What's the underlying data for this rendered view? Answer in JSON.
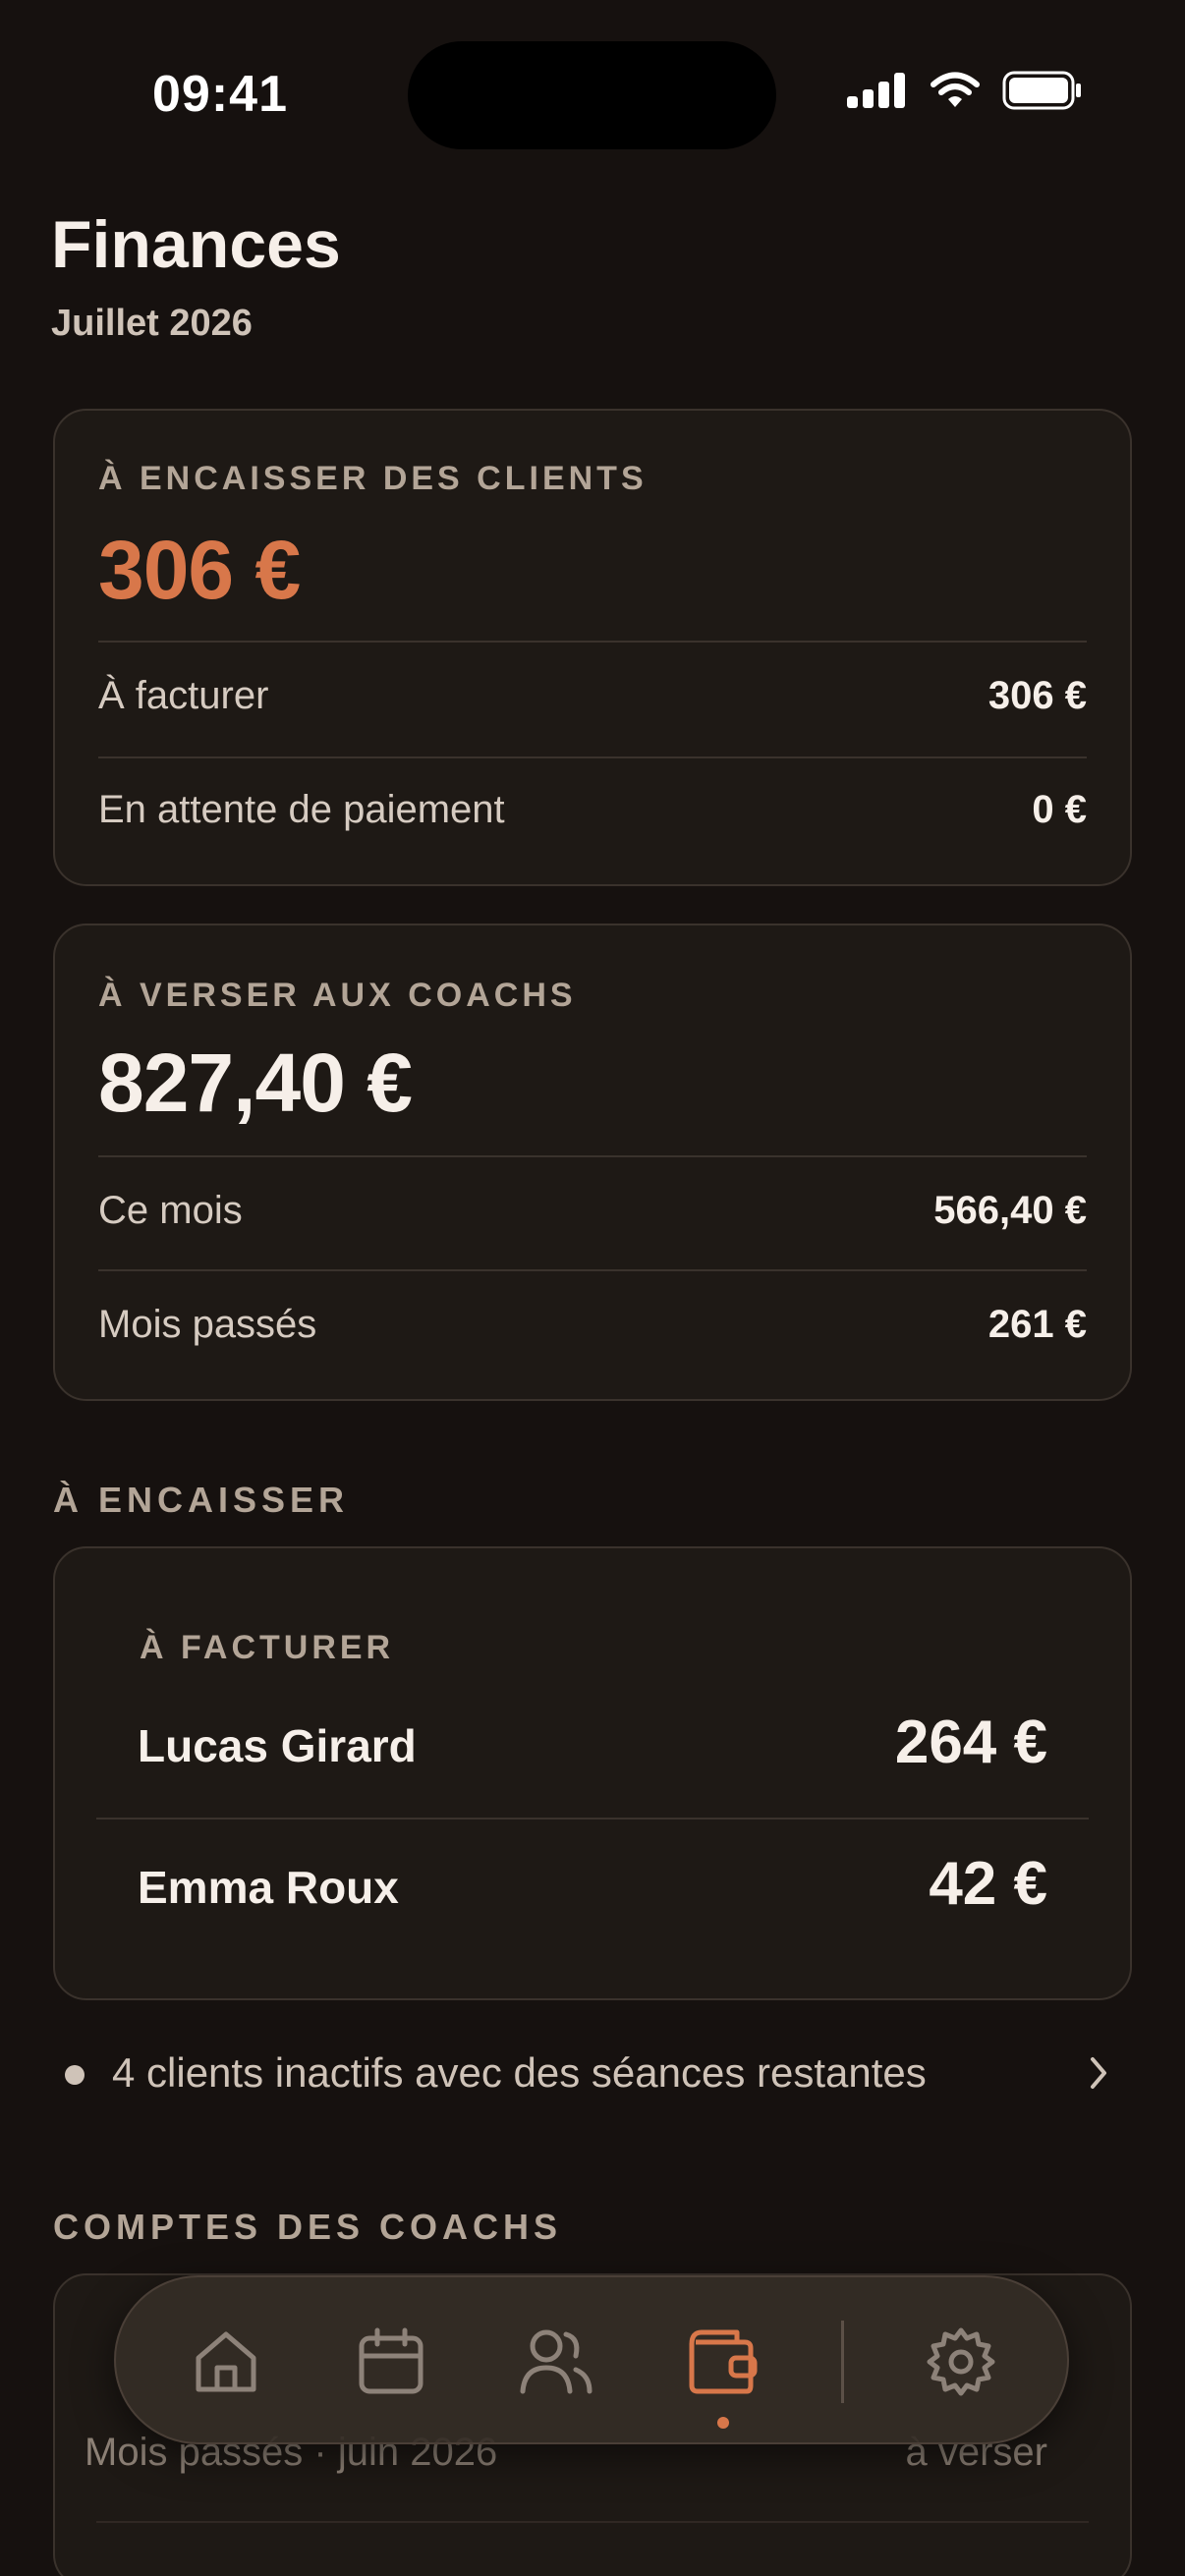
{
  "status_bar": {
    "time": "09:41"
  },
  "header": {
    "title": "Finances",
    "subtitle": "Juillet 2026"
  },
  "clients_card": {
    "label": "À ENCAISSER DES CLIENTS",
    "amount": "306 €",
    "rows": [
      {
        "label": "À facturer",
        "value": "306 €"
      },
      {
        "label": "En attente de paiement",
        "value": "0 €"
      }
    ]
  },
  "coachs_card": {
    "label": "À VERSER AUX COACHS",
    "amount": "827,40 €",
    "rows": [
      {
        "label": "Ce mois",
        "value": "566,40 €"
      },
      {
        "label": "Mois passés",
        "value": "261 €"
      }
    ]
  },
  "a_encaisser": {
    "section_title": "À ENCAISSER",
    "group_label": "À FACTURER",
    "clients": [
      {
        "name": "Lucas Girard",
        "amount": "264 €"
      },
      {
        "name": "Emma Roux",
        "amount": "42 €"
      }
    ]
  },
  "inactive": {
    "text": "4 clients inactifs avec des séances restantes"
  },
  "comptes_coachs": {
    "section_title": "COMPTES DES COACHS",
    "sub_left": "Mois passés · juin 2026",
    "sub_right": "à verser"
  },
  "tab_bar": {
    "tabs": [
      {
        "icon": "home-icon"
      },
      {
        "icon": "calendar-icon"
      },
      {
        "icon": "users-icon"
      },
      {
        "icon": "wallet-icon",
        "active": true
      },
      {
        "icon": "gear-icon"
      }
    ],
    "accent_color": "#d8774a",
    "inactive_color": "#8d8279"
  }
}
